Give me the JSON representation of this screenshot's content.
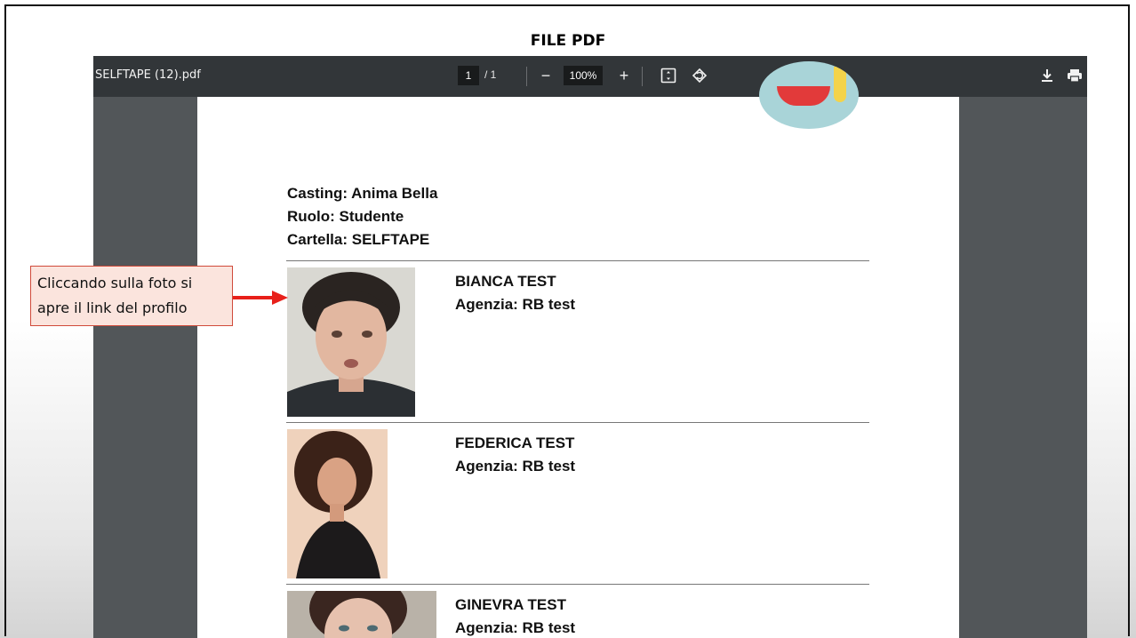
{
  "slide_title": "FILE PDF",
  "viewer": {
    "filename": "SELFTAPE (12).pdf",
    "current_page": "1",
    "page_separator": "/ 1",
    "zoom": "100%",
    "zoom_out_label": "−",
    "zoom_in_label": "+",
    "fit_icon": "⊡",
    "rotate_icon": "⟲",
    "download_icon": "⭳",
    "print_icon": "🖶"
  },
  "document": {
    "casting": "Casting: Anima Bella",
    "ruolo": "Ruolo: Studente",
    "cartella": "Cartella: SELFTAPE",
    "profiles": [
      {
        "name": "BIANCA TEST",
        "agency": "Agenzia: RB test"
      },
      {
        "name": "FEDERICA TEST",
        "agency": "Agenzia: RB test"
      },
      {
        "name": "GINEVRA TEST",
        "agency": "Agenzia: RB test"
      }
    ]
  },
  "callout": {
    "line1": "Cliccando sulla foto si",
    "line2": "apre il link del profilo"
  },
  "colors": {
    "toolbar": "#323639",
    "viewer_bg": "#525659",
    "callout_bg": "#fbe4dd",
    "arrow": "#e8201a"
  }
}
